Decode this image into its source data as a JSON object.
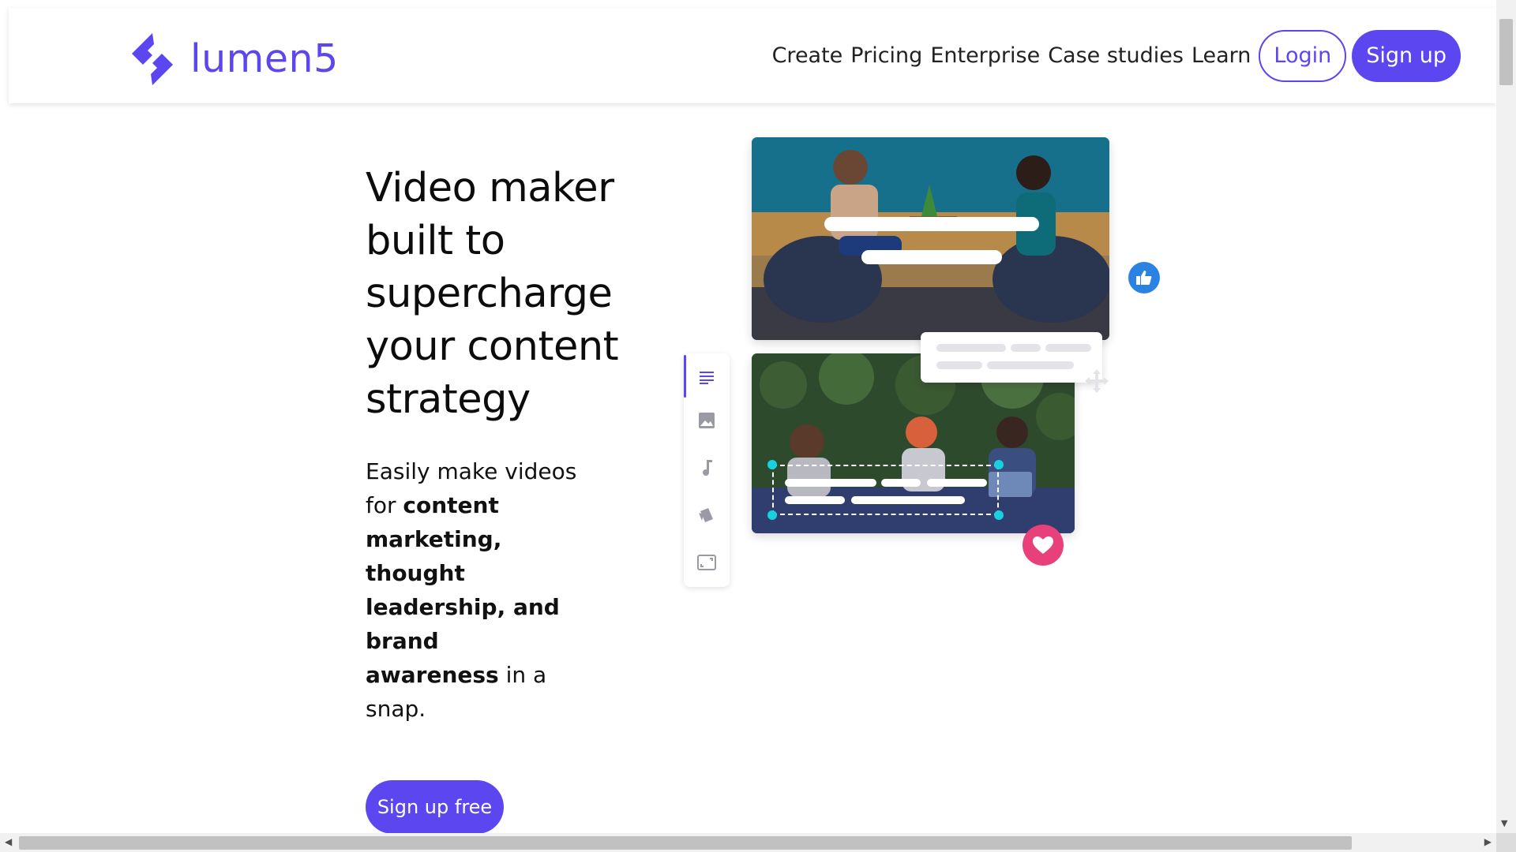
{
  "brand": {
    "name": "lumen5",
    "color": "#5b46ef"
  },
  "nav": {
    "links": [
      "Create",
      "Pricing",
      "Enterprise",
      "Case studies",
      "Learn"
    ],
    "login_label": "Login",
    "signup_label": "Sign up"
  },
  "hero": {
    "title": "Video maker built to supercharge your content strategy",
    "subtitle_prefix": "Easily make videos for",
    "subtitle_bold": "content marketing, thought leadership, and brand awareness",
    "subtitle_suffix": "in a snap.",
    "cta_label": "Sign up free"
  },
  "toolbar": {
    "items": [
      "text-icon",
      "image-icon",
      "music-icon",
      "style-icon",
      "aspect-ratio-icon"
    ],
    "active": "text-icon"
  },
  "colors": {
    "accent": "#5b46ef",
    "like": "#2a83e3",
    "heart": "#e8407a",
    "handle": "#19d0e0"
  }
}
